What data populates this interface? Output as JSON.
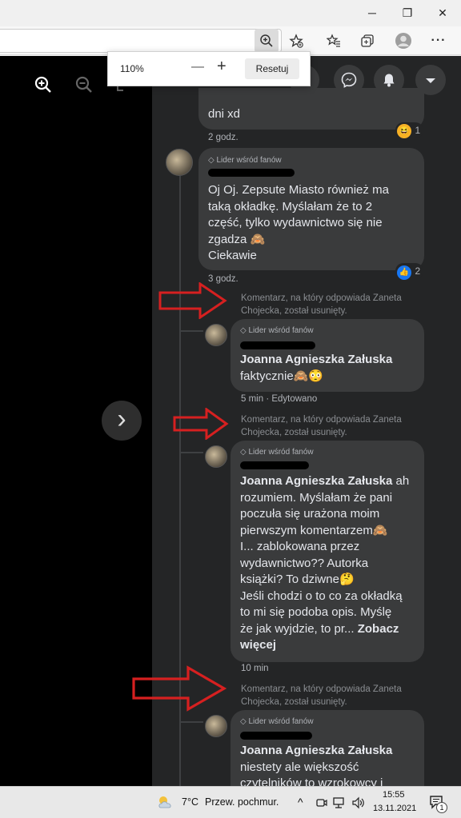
{
  "window": {
    "minimize": "─",
    "maximize": "❐",
    "close": "✕"
  },
  "toolbar": {
    "icons": [
      "zoom-in-icon",
      "favorite-add-icon",
      "favorites-icon",
      "collections-icon",
      "profile-icon",
      "more-icon"
    ],
    "more": "···"
  },
  "zoom_popup": {
    "level": "110%",
    "minus": "—",
    "plus": "+",
    "reset": "Resetuj"
  },
  "viewer": {
    "next": "›"
  },
  "header": {
    "icons": [
      "menu-grid-icon",
      "messenger-icon",
      "notifications-icon",
      "account-dropdown-icon"
    ]
  },
  "comments": [
    {
      "text": "dni xd",
      "time": "2 godz.",
      "reaction_count": "1",
      "reaction_emoji": "😆"
    },
    {
      "badge": "Lider wśród fanów",
      "lines": [
        "Oj Oj. Zepsute Miasto również ma",
        "taką okładkę. Myślałam że to 2",
        "część, tylko wydawnictwo się nie",
        "zgadza 🙈",
        "Ciekawie"
      ],
      "time": "3 godz.",
      "reaction_count": "2",
      "reaction_emoji": "👍"
    },
    {
      "deleted_notice": [
        "Komentarz, na który odpowiada Zaneta",
        "Chojecka, został usunięty."
      ],
      "badge": "Lider wśród fanów",
      "author": "Joanna Agnieszka Załuska",
      "lines": [
        "faktycznie🙈😳"
      ],
      "time": "5 min · Edytowano"
    },
    {
      "deleted_notice": [
        "Komentarz, na który odpowiada Zaneta",
        "Chojecka, został usunięty."
      ],
      "badge": "Lider wśród fanów",
      "author": "Joanna Agnieszka Załuska",
      "first_line_rest": " ah",
      "lines": [
        "rozumiem. Myślałam że pani",
        "poczuła się urażona moim",
        "pierwszym komentarzem🙈",
        "I... zablokowana przez",
        "wydawnictwo?? Autorka",
        "książki? To dziwne🤔",
        "Jeśli chodzi o to co za okładką",
        "to mi się podoba opis. Myślę",
        "że jak wyjdzie, to pr..."
      ],
      "see_more_a": "Zobacz",
      "see_more_b": "więcej",
      "time": "10 min"
    },
    {
      "deleted_notice": [
        "Komentarz, na który odpowiada Zaneta",
        "Chojecka, został usunięty."
      ],
      "badge": "Lider wśród fanów",
      "author": "Joanna Agnieszka Załuska",
      "lines": [
        "niestety ale większość",
        "czytelników to wzrokowcy i"
      ]
    }
  ],
  "taskbar": {
    "temperature": "7°C",
    "weather": "Przew. pochmur.",
    "time": "15:55",
    "date": "13.11.2021",
    "notifications": "1",
    "chevron": "^"
  },
  "colors": {
    "panel_bg": "#242526",
    "bubble_bg": "#3a3b3c",
    "text": "#e4e6eb",
    "muted": "#b0b3b8",
    "arrow": "#d62020"
  }
}
